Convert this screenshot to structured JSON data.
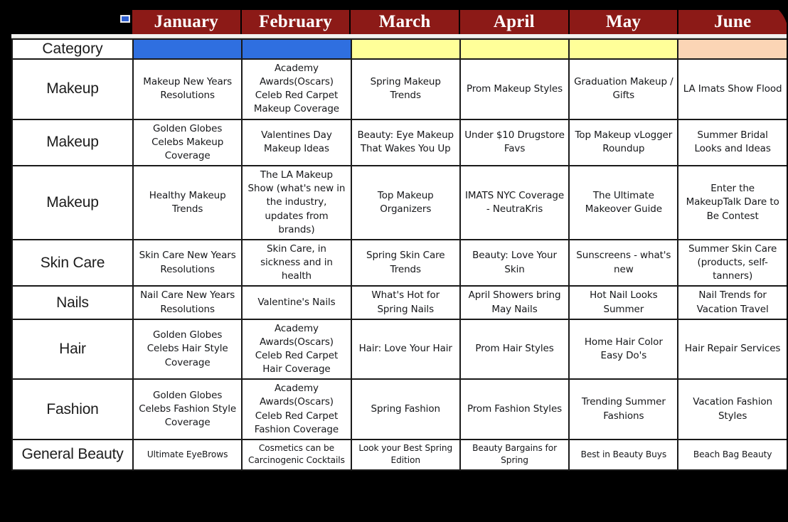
{
  "header": {
    "marker_icon": "cell-marker-icon",
    "months": [
      "January",
      "February",
      "March",
      "April",
      "May",
      "June"
    ]
  },
  "colors": {
    "header_red": "#8C1A17",
    "header_text": "#FFFFFF",
    "swatch_blue": "#2F6FE0",
    "swatch_yellow": "#FFFF99",
    "swatch_peach": "#FBD5B5",
    "grid_line": "#1A1A1A",
    "backdrop": "#000000",
    "sheet": "#FFFFFF"
  },
  "category_row": {
    "label": "Category",
    "swatches": [
      "#2F6FE0",
      "#2F6FE0",
      "#FFFF99",
      "#FFFF99",
      "#FFFF99",
      "#FBD5B5"
    ]
  },
  "rows": [
    {
      "category": "Makeup",
      "cells": [
        "Makeup New Years Resolutions",
        "Academy Awards(Oscars) Celeb Red Carpet Makeup Coverage",
        "Spring Makeup Trends",
        "Prom Makeup Styles",
        "Graduation Makeup / Gifts",
        "LA Imats Show Flood"
      ]
    },
    {
      "category": "Makeup",
      "cells": [
        "Golden Globes Celebs Makeup Coverage",
        "Valentines Day Makeup Ideas",
        "Beauty: Eye Makeup That Wakes You Up",
        "Under $10 Drugstore Favs",
        "Top Makeup vLogger Roundup",
        "Summer Bridal Looks and Ideas"
      ]
    },
    {
      "category": "Makeup",
      "cells": [
        "Healthy Makeup Trends",
        "The LA Makeup Show (what's new in the industry, updates from brands)",
        "Top Makeup Organizers",
        "IMATS NYC Coverage - NeutraKris",
        "The Ultimate Makeover Guide",
        "Enter the MakeupTalk Dare to Be Contest"
      ]
    },
    {
      "category": "Skin Care",
      "cells": [
        "Skin Care New Years Resolutions",
        "Skin Care, in sickness and in health",
        "Spring Skin Care Trends",
        "Beauty: Love Your Skin",
        "Sunscreens - what's new",
        "Summer Skin Care (products, self-tanners)"
      ]
    },
    {
      "category": "Nails",
      "cells": [
        "Nail Care New Years Resolutions",
        "Valentine's Nails",
        "What's Hot for Spring Nails",
        "April Showers bring May Nails",
        "Hot Nail Looks Summer",
        "Nail Trends for Vacation Travel"
      ]
    },
    {
      "category": "Hair",
      "cells": [
        "Golden Globes Celebs Hair Style Coverage",
        "Academy Awards(Oscars) Celeb Red Carpet Hair Coverage",
        "Hair: Love Your Hair",
        "Prom Hair Styles",
        "Home Hair Color Easy Do's",
        "Hair Repair Services"
      ]
    },
    {
      "category": "Fashion",
      "cells": [
        "Golden Globes Celebs Fashion Style Coverage",
        "Academy Awards(Oscars) Celeb Red Carpet Fashion Coverage",
        "Spring Fashion",
        "Prom Fashion Styles",
        "Trending Summer Fashions",
        "Vacation Fashion Styles"
      ]
    },
    {
      "category": "General Beauty",
      "cells": [
        "Ultimate EyeBrows",
        "Cosmetics can be Carcinogenic Cocktails",
        "Look your Best Spring Edition",
        "Beauty Bargains for Spring",
        "Best in Beauty Buys",
        "Beach Bag Beauty"
      ]
    }
  ]
}
